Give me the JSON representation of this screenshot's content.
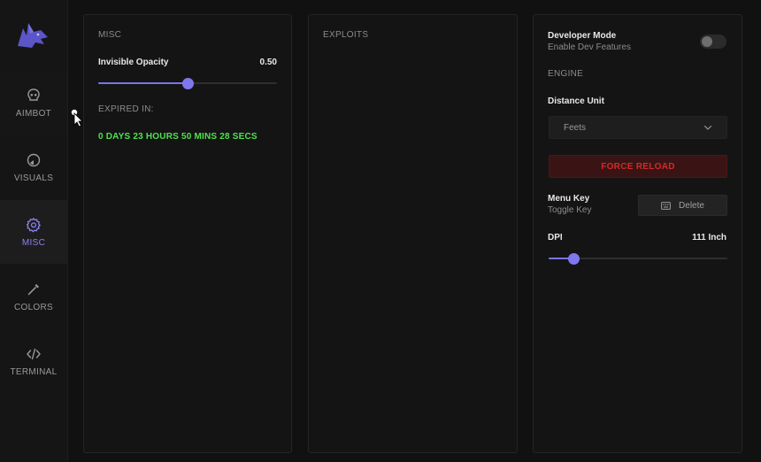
{
  "sidebar": {
    "items": [
      {
        "label": "AIMBOT",
        "icon": "skull-icon"
      },
      {
        "label": "VISUALS",
        "icon": "visuals-icon"
      },
      {
        "label": "MISC",
        "icon": "gear-icon"
      },
      {
        "label": "COLORS",
        "icon": "eyedropper-icon"
      },
      {
        "label": "TERMINAL",
        "icon": "code-icon"
      }
    ],
    "active": "MISC"
  },
  "misc": {
    "title": "MISC",
    "opacity_label": "Invisible Opacity",
    "opacity_value_text": "0.50",
    "opacity_fraction": 0.5,
    "expired_label": "EXPIRED IN:",
    "expired_value": "0 DAYS 23 HOURS 50 MINS 28 SECS"
  },
  "exploits": {
    "title": "EXPLOITS"
  },
  "settings": {
    "dev_mode_label": "Developer Mode",
    "dev_mode_sub": "Enable Dev Features",
    "dev_mode_on": false,
    "engine_title": "ENGINE",
    "distance_label": "Distance Unit",
    "distance_value": "Feets",
    "force_reload_label": "FORCE RELOAD",
    "menu_key_label": "Menu Key",
    "menu_key_sub": "Toggle Key",
    "menu_key_value": "Delete",
    "dpi_label": "DPI",
    "dpi_value_text": "111 Inch",
    "dpi_fraction": 0.14
  },
  "colors": {
    "accent": "#7f77ee",
    "timer": "#4ee24e",
    "danger": "#d22a2a"
  }
}
